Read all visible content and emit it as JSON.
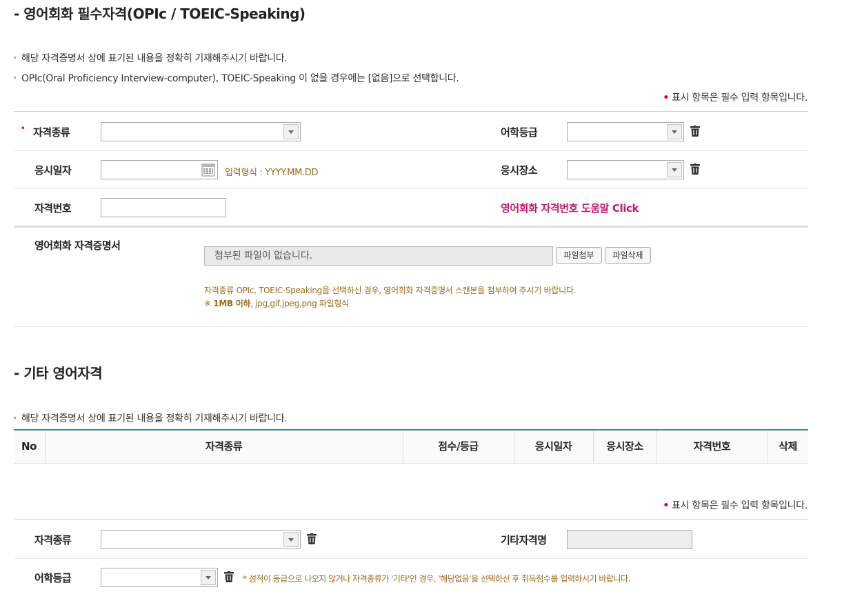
{
  "section1": {
    "title": "- 영어회화 필수자격(OPIc / TOEIC-Speaking)",
    "notes": [
      "해당 자격증명서 상에 표기된 내용을 정확히 기재해주시기 바랍니다.",
      "OPIc(Oral Proficiency Interview-computer), TOEIC-Speaking 이 없을 경우에는 [없음]으로 선택합니다."
    ],
    "required_note_dot": "•",
    "required_note": "표시 항목은 필수 입력 항목입니다.",
    "fields": {
      "cert_type_label": "자격종류",
      "language_grade_label": "어학등급",
      "exam_date_label": "응시일자",
      "date_format_hint": "입력형식 : YYYY.MM.DD",
      "exam_place_label": "응시장소",
      "cert_number_label": "자격번호",
      "cert_number_help": "영어회화 자격번호 도움말 Click"
    },
    "attachment": {
      "label": "영어회화 자격증명서",
      "file_placeholder": "첨부된 파일이 없습니다.",
      "attach_button": "파일첨부",
      "delete_button": "파일삭제",
      "hint_line1": "자격종류 OPIc, TOEIC-Speaking을 선택하신 경우, 영어회화 자격증명서 스캔본을 첨부하여 주시기 바랍니다.",
      "hint_line2_prefix": "※ ",
      "hint_line2_bold": "1MB 이하",
      "hint_line2_rest": ", jpg,gif,jpeg,png 파일형식"
    }
  },
  "section2": {
    "title": "- 기타 영어자격",
    "note": "해당 자격증명서 상에 표기된 내용을 정확히 기재해주시기 바랍니다.",
    "table_headers": [
      "No",
      "자격종류",
      "점수/등급",
      "응시일자",
      "응시장소",
      "자격번호",
      "삭제"
    ],
    "required_note_dot": "•",
    "required_note": "표시 항목은 필수 입력 항목입니다.",
    "fields": {
      "cert_type_label": "자격종류",
      "other_cert_name_label": "기타자격명",
      "language_grade_label": "어학등급",
      "grade_hint": "* 성적이 등급으로 나오지 않거나 자격종류가 '기타'인 경우, '해당없음'을 선택하신 후 취득점수를 입력하시기 바랍니다."
    }
  },
  "colors": {
    "required_dot": "#d0021b",
    "hint_text": "#9c6a1a",
    "help_link": "#c8166a",
    "table_top_border": "#2a8ab0"
  },
  "icons": [
    "trash-icon",
    "calendar-icon",
    "chevron-down-icon"
  ]
}
